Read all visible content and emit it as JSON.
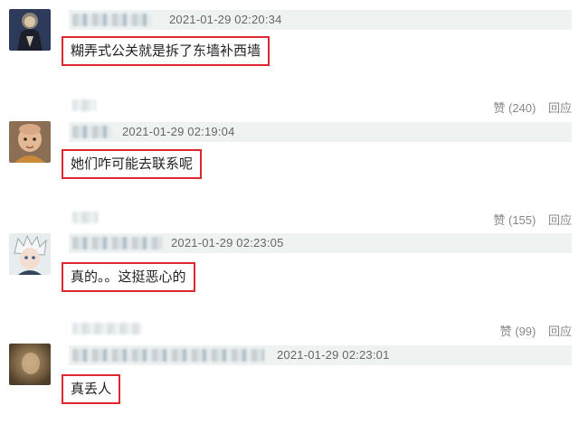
{
  "comments": [
    {
      "avatar": "dark-robed-figure-avatar",
      "timestamp": "2021-01-29 02:20:34",
      "content": "糊弄式公关就是拆了东墙补西墙",
      "like_label": "赞 (240)",
      "reply_label": "回应"
    },
    {
      "avatar": "child-monk-avatar",
      "timestamp": "2021-01-29 02:19:04",
      "content": "她们咋可能去联系呢",
      "like_label": "赞 (155)",
      "reply_label": "回应"
    },
    {
      "avatar": "anime-white-hair-avatar",
      "timestamp": "2021-01-29 02:23:05",
      "content": "真的。。这挺恶心的",
      "like_label": "赞 (99)",
      "reply_label": "回应"
    },
    {
      "avatar": "blurry-photo-avatar",
      "timestamp": "2021-01-29 02:23:01",
      "content": "真丢人"
    }
  ],
  "colors": {
    "highlight_border": "#e0262e",
    "meta_bar": "#eef3f2",
    "muted_text": "#888888"
  }
}
